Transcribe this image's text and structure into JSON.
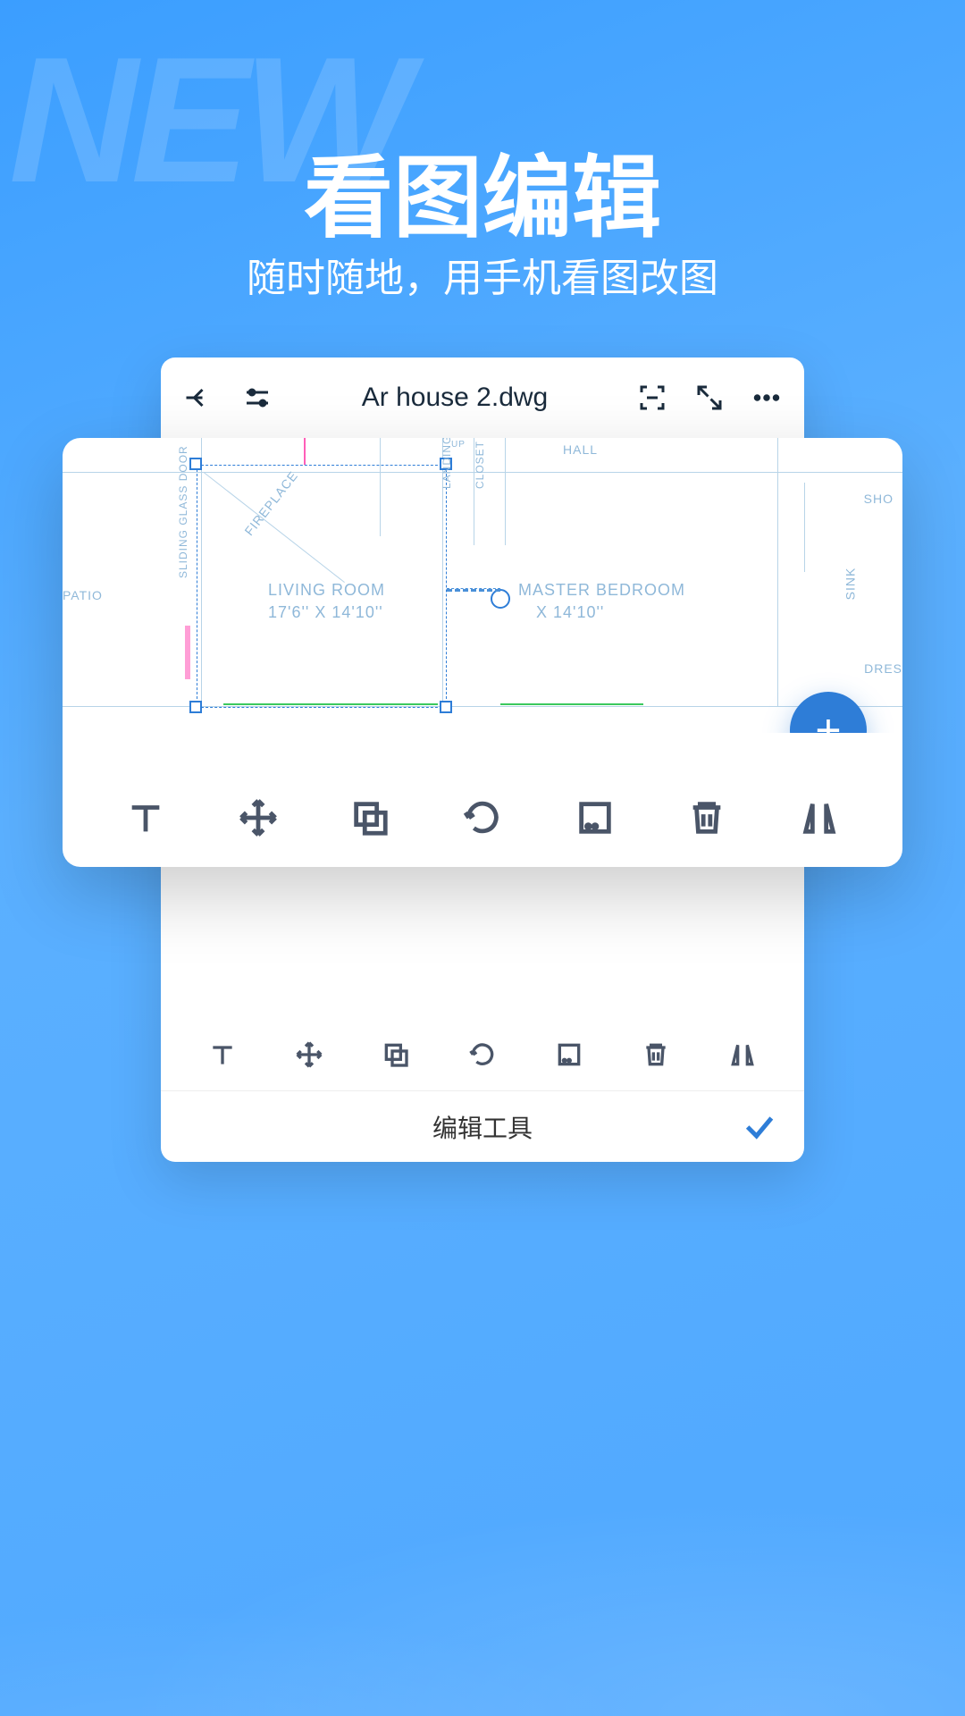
{
  "bg_text": "NEW",
  "title": "看图编辑",
  "subtitle": "随时随地，用手机看图改图",
  "file_name": "Ar house 2.dwg",
  "bottom_label": "编辑工具",
  "fab_label": "+",
  "rooms": {
    "patio": "PATIO",
    "living_room": "LIVING ROOM",
    "living_dim": "17'6'' X 14'10''",
    "master_bedroom": "MASTER BEDROOM",
    "master_dim": "X 14'10''",
    "fireplace": "FIREPLACE",
    "landing": "LANDING",
    "closet": "CLOSET",
    "hall": "HALL",
    "glass_door": "SLIDING GLASS DOOR",
    "sink": "SINK",
    "dres": "DRES",
    "sho": "SHO",
    "up": "UP"
  }
}
